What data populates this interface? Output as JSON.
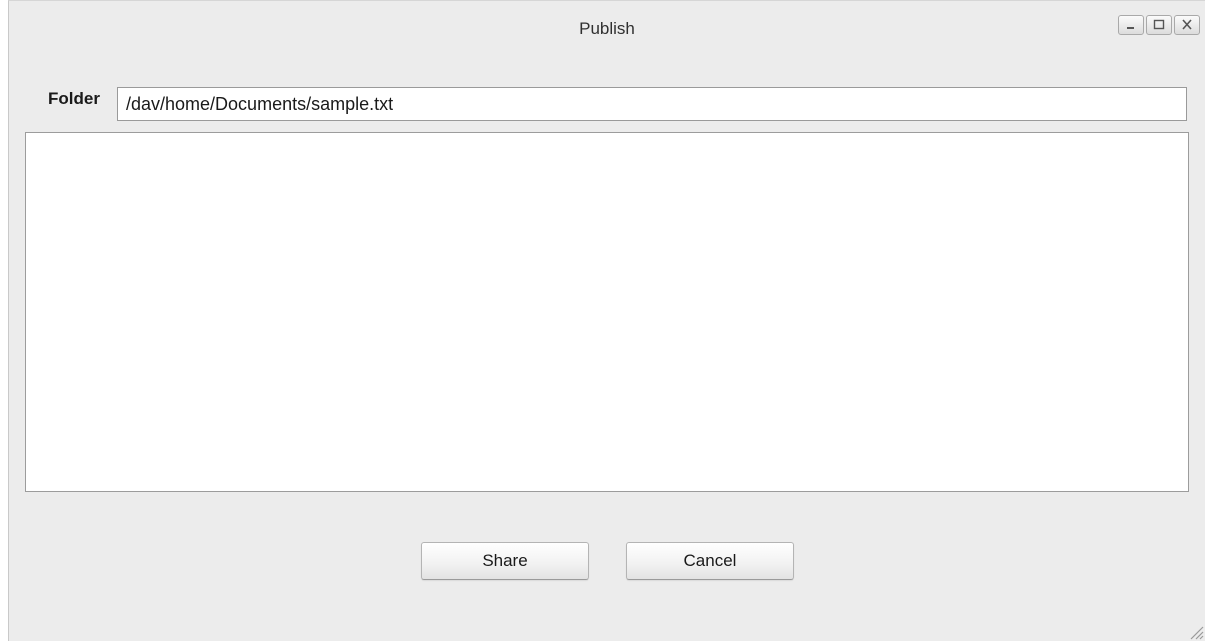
{
  "window": {
    "title": "Publish",
    "controls": [
      "minimize-icon",
      "maximize-icon",
      "close-icon"
    ]
  },
  "folder": {
    "label": "Folder",
    "value": "/dav/home/Documents/sample.txt"
  },
  "actions": {
    "share_label": "Share",
    "cancel_label": "Cancel"
  }
}
